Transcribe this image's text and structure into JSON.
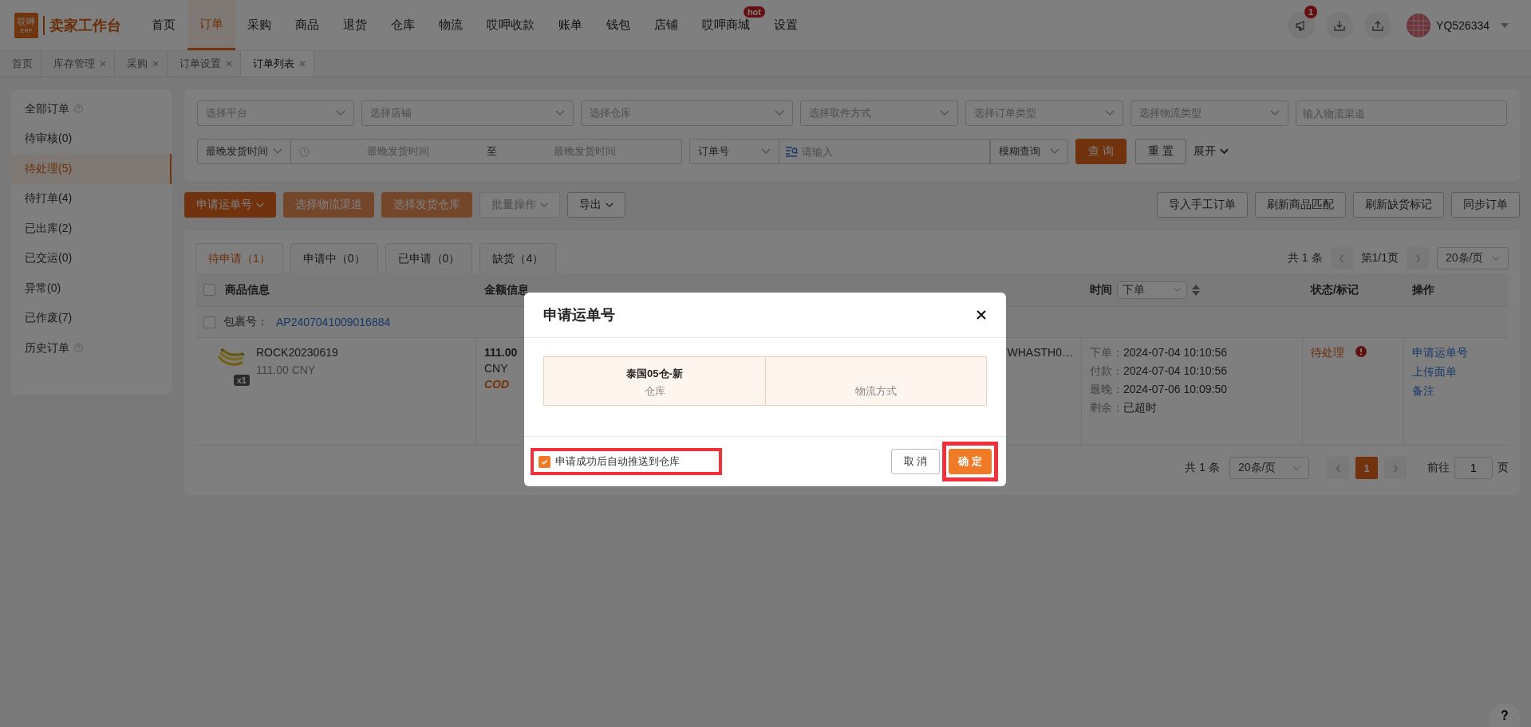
{
  "topbar": {
    "logo_text": "哎呷",
    "logo_sub": "ERP",
    "brand": "卖家工作台",
    "nav": [
      {
        "label": "首页",
        "selected": false
      },
      {
        "label": "订单",
        "selected": true
      },
      {
        "label": "采购",
        "selected": false
      },
      {
        "label": "商品",
        "selected": false
      },
      {
        "label": "退货",
        "selected": false
      },
      {
        "label": "仓库",
        "selected": false
      },
      {
        "label": "物流",
        "selected": false
      },
      {
        "label": "哎呷收款",
        "selected": false
      },
      {
        "label": "账单",
        "selected": false
      },
      {
        "label": "钱包",
        "selected": false
      },
      {
        "label": "店铺",
        "selected": false
      },
      {
        "label": "哎呷商城",
        "selected": false,
        "badge": "hot"
      },
      {
        "label": "设置",
        "selected": false
      }
    ],
    "notification_count": "1",
    "user": "YQ526334"
  },
  "page_tabs": [
    {
      "label": "首页",
      "closable": false,
      "selected": false
    },
    {
      "label": "库存管理",
      "closable": true,
      "selected": false
    },
    {
      "label": "采购",
      "closable": true,
      "selected": false
    },
    {
      "label": "订单设置",
      "closable": true,
      "selected": false
    },
    {
      "label": "订单列表",
      "closable": true,
      "selected": true
    }
  ],
  "sidebar": [
    {
      "label": "全部订单",
      "help": true,
      "selected": false
    },
    {
      "label": "待审核(0)",
      "help": false,
      "selected": false
    },
    {
      "label": "待处理(5)",
      "help": false,
      "selected": true
    },
    {
      "label": "待打单(4)",
      "help": false,
      "selected": false
    },
    {
      "label": "已出库(2)",
      "help": false,
      "selected": false
    },
    {
      "label": "已交运(0)",
      "help": false,
      "selected": false
    },
    {
      "label": "异常(0)",
      "help": false,
      "selected": false
    },
    {
      "label": "已作废(7)",
      "help": false,
      "selected": false
    },
    {
      "label": "历史订单",
      "help": true,
      "selected": false
    }
  ],
  "filters": {
    "selects": [
      "选择平台",
      "选择店铺",
      "选择仓库",
      "选择取件方式",
      "选择订单类型",
      "选择物流类型"
    ],
    "channel_placeholder": "输入物流渠道",
    "time_type": "最晚发货时间",
    "start_placeholder": "最晚发货时间",
    "range_sep": "至",
    "end_placeholder": "最晚发货时间",
    "order_field": "订单号",
    "search_placeholder": "请输入",
    "match_mode": "模糊查询",
    "query": "查 询",
    "reset": "重 置",
    "expand": "展开"
  },
  "toolbar": {
    "left": [
      {
        "label": "申请运单号",
        "kind": "primary",
        "dropdown": true
      },
      {
        "label": "选择物流渠道",
        "kind": "light",
        "dropdown": false
      },
      {
        "label": "选择发货仓库",
        "kind": "light",
        "dropdown": false
      },
      {
        "label": "批量操作",
        "kind": "disabled",
        "dropdown": true
      },
      {
        "label": "导出",
        "kind": "default",
        "dropdown": true
      }
    ],
    "right": [
      "导入手工订单",
      "刷新商品匹配",
      "刷新缺货标记",
      "同步订单"
    ]
  },
  "status_tabs": [
    {
      "label": "待申请（1）",
      "selected": true
    },
    {
      "label": "申请中（0）",
      "selected": false
    },
    {
      "label": "已申请（0）",
      "selected": false
    },
    {
      "label": "缺货（4）",
      "selected": false
    }
  ],
  "pager_top": {
    "total": "共 1 条",
    "page": "第1/1页",
    "page_size": "20条/页"
  },
  "table": {
    "header_checked": false,
    "product_column": "商品信息",
    "amount_column": "金额信息",
    "time_column": "时间",
    "status_column": "状态/标记",
    "action_column": "操作",
    "time_sort": "下单",
    "package": {
      "label": "包裹号：",
      "number": "AP2407041009016884",
      "checked": false
    },
    "row": {
      "sku": "ROCK20230619",
      "price": "111.00 CNY",
      "qty": "x1",
      "amount": "111.00",
      "currency": "CNY",
      "payment": "COD",
      "warehouse": "WHASTH0…",
      "times": [
        {
          "label": "下单：",
          "value": "2024-07-04 10:10:56"
        },
        {
          "label": "付款：",
          "value": "2024-07-04 10:10:56"
        },
        {
          "label": "最晚：",
          "value": "2024-07-06 10:09:50"
        },
        {
          "label": "剩余：",
          "value": "已超时"
        }
      ],
      "status": "待处理",
      "status_alert": true,
      "actions": [
        "申请运单号",
        "上传面单",
        "备注"
      ]
    }
  },
  "pager_bottom": {
    "total": "共 1 条",
    "page_size": "20条/页",
    "pages": [
      {
        "label": "1",
        "selected": true
      }
    ],
    "goto_label": "前往",
    "goto_value": "1",
    "goto_suffix": "页"
  },
  "modal": {
    "title": "申请运单号",
    "cells": [
      {
        "value": "泰国05仓-新",
        "label": "仓库"
      },
      {
        "label": "物流方式"
      }
    ],
    "auto_push": {
      "label": "申请成功后自动推送到仓库",
      "checked": true,
      "highlighted": true
    },
    "cancel": "取 消",
    "confirm": "确 定",
    "confirm_highlighted": true
  },
  "help_button": "?"
}
